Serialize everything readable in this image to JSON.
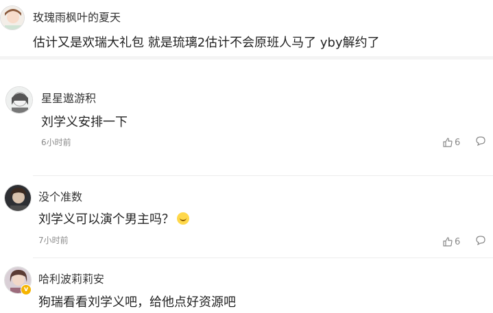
{
  "comments": [
    {
      "user": "玫瑰雨枫叶的夏天",
      "text": "估计又是欢瑞大礼包 就是琉璃2估计不会原班人马了 yby解约了"
    },
    {
      "user": "星星遨游积",
      "text": "刘学义安排一下",
      "time": "6小时前",
      "likes": "6"
    },
    {
      "user": "没个准数",
      "text": "刘学义可以演个男主吗？",
      "emoji": "laugh-cry-emoji",
      "time": "7小时前",
      "likes": "6"
    },
    {
      "user": "哈利波莉莉安",
      "text": "狗瑞看看刘学义吧，给他点好资源吧",
      "badge": "v"
    }
  ],
  "colors": {
    "badge": "#f5b400",
    "muted": "#8a8a8a"
  }
}
